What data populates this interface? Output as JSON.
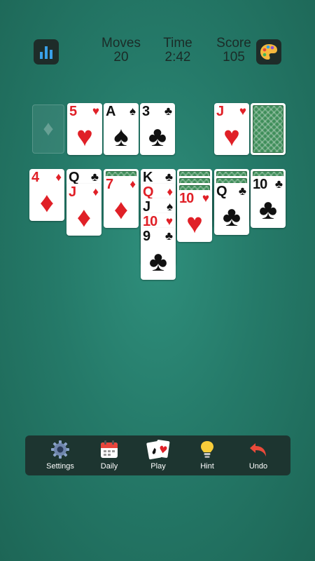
{
  "header": {
    "moves_label": "Moves",
    "moves_value": "20",
    "time_label": "Time",
    "time_value": "2:42",
    "score_label": "Score",
    "score_value": "105"
  },
  "icons": {
    "stats": "bar-chart-icon",
    "theme": "palette-icon"
  },
  "colors": {
    "felt": "#257a69",
    "toolbar": "#1d3530",
    "red_suit": "#e02027",
    "card_back": "#3f8e5a"
  },
  "foundations": [
    {
      "empty": true,
      "suit": "♦"
    },
    {
      "rank": "5",
      "suit": "♥"
    },
    {
      "rank": "A",
      "suit": "♠"
    },
    {
      "rank": "3",
      "suit": "♣"
    }
  ],
  "waste_top": {
    "rank": "J",
    "suit": "♥"
  },
  "tableau": [
    {
      "face_down": 0,
      "face_up": [
        {
          "rank": "4",
          "suit": "♦"
        }
      ]
    },
    {
      "face_down": 0,
      "face_up": [
        {
          "rank": "Q",
          "suit": "♣"
        },
        {
          "rank": "J",
          "suit": "♦"
        }
      ]
    },
    {
      "face_down": 1,
      "face_up": [
        {
          "rank": "7",
          "suit": "♦"
        }
      ]
    },
    {
      "face_down": 0,
      "face_up": [
        {
          "rank": "K",
          "suit": "♣"
        },
        {
          "rank": "Q",
          "suit": "♦"
        },
        {
          "rank": "J",
          "suit": "♠"
        },
        {
          "rank": "10",
          "suit": "♥"
        },
        {
          "rank": "9",
          "suit": "♣"
        }
      ]
    },
    {
      "face_down": 3,
      "face_up": [
        {
          "rank": "10",
          "suit": "♥"
        }
      ]
    },
    {
      "face_down": 2,
      "face_up": [
        {
          "rank": "Q",
          "suit": "♣"
        }
      ]
    },
    {
      "face_down": 1,
      "face_up": [
        {
          "rank": "10",
          "suit": "♣"
        }
      ]
    }
  ],
  "toolbar": {
    "settings": "Settings",
    "daily": "Daily",
    "play": "Play",
    "hint": "Hint",
    "undo": "Undo"
  }
}
